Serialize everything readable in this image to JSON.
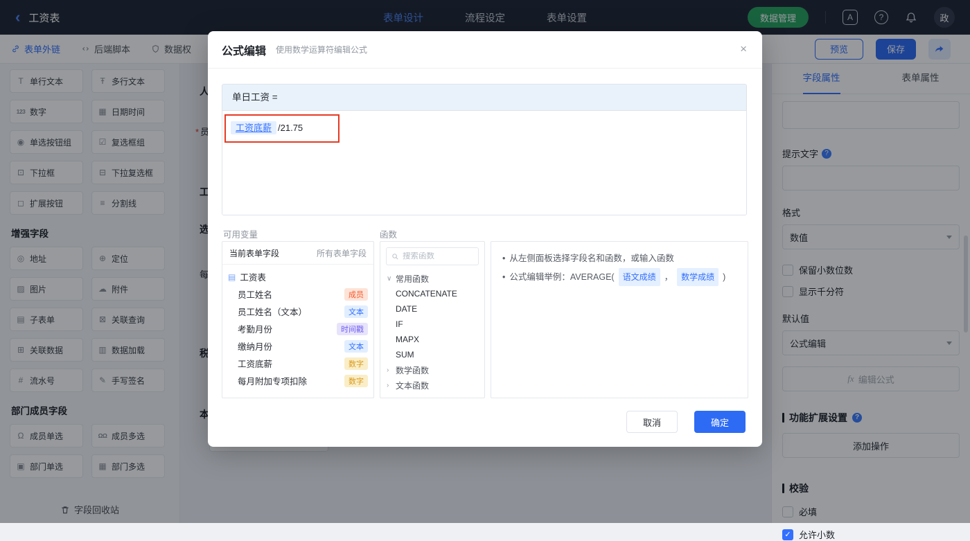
{
  "topbar": {
    "back_glyph": "‹",
    "title": "工资表",
    "tabs": [
      {
        "label": "表单设计"
      },
      {
        "label": "流程设定"
      },
      {
        "label": "表单设置"
      }
    ],
    "data_manage": "数据管理",
    "language_glyph": "A",
    "help_glyph": "?",
    "avatar": "政"
  },
  "toolbar": {
    "form_link": "表单外链",
    "backend_script": "后端脚本",
    "data_permission": "数据权",
    "preview": "预览",
    "save": "保存"
  },
  "sidebar": {
    "basic_fields": [
      {
        "icon": "T",
        "label": "单行文本"
      },
      {
        "icon": "Ŧ",
        "label": "多行文本"
      },
      {
        "icon": "123",
        "label": "数字"
      },
      {
        "icon": "▦",
        "label": "日期时间"
      },
      {
        "icon": "◉",
        "label": "单选按钮组"
      },
      {
        "icon": "☑",
        "label": "复选框组"
      },
      {
        "icon": "⊡",
        "label": "下拉框"
      },
      {
        "icon": "⊟",
        "label": "下拉复选框"
      },
      {
        "icon": "◻",
        "label": "扩展按钮"
      },
      {
        "icon": "≡",
        "label": "分割线"
      }
    ],
    "enhanced_title": "增强字段",
    "enhanced_fields": [
      {
        "icon": "◎",
        "label": "地址"
      },
      {
        "icon": "⊕",
        "label": "定位"
      },
      {
        "icon": "▨",
        "label": "图片"
      },
      {
        "icon": "☁",
        "label": "附件"
      },
      {
        "icon": "▤",
        "label": "子表单"
      },
      {
        "icon": "⊠",
        "label": "关联查询"
      },
      {
        "icon": "⊞",
        "label": "关联数据"
      },
      {
        "icon": "▥",
        "label": "数据加载"
      },
      {
        "icon": "#",
        "label": "流水号"
      },
      {
        "icon": "✎",
        "label": "手写签名"
      }
    ],
    "dept_title": "部门成员字段",
    "dept_fields": [
      {
        "icon": "Ω",
        "label": "成员单选"
      },
      {
        "icon": "ΩΩ",
        "label": "成员多选"
      },
      {
        "icon": "▣",
        "label": "部门单选"
      },
      {
        "icon": "▦",
        "label": "部门多选"
      }
    ],
    "recycle": "字段回收站"
  },
  "canvas": {
    "required_mark": "*",
    "fragments": [
      {
        "text": "人"
      },
      {
        "text": "员"
      },
      {
        "text": "工"
      },
      {
        "text": "选"
      },
      {
        "text": "每"
      },
      {
        "text": "税"
      },
      {
        "text": "本"
      }
    ]
  },
  "modal": {
    "title": "公式编辑",
    "subtitle": "使用数学运算符编辑公式",
    "close_glyph": "×",
    "formula_target": "单日工资 =",
    "formula_chip": "工资底薪",
    "formula_rest": "/21.75",
    "variables_label": "可用变量",
    "functions_label": "函数",
    "variables": {
      "tab_current": "当前表单字段",
      "tab_all": "所有表单字段",
      "root_glyph": "▤",
      "root": "工资表",
      "fields": [
        {
          "name": "员工姓名",
          "tag": "成员"
        },
        {
          "name": "员工姓名（文本）",
          "tag": "文本"
        },
        {
          "name": "考勤月份",
          "tag": "时间戳"
        },
        {
          "name": "缴纳月份",
          "tag": "文本"
        },
        {
          "name": "工资底薪",
          "tag": "数字"
        },
        {
          "name": "每月附加专项扣除",
          "tag": "数字"
        }
      ]
    },
    "functions": {
      "search_placeholder": "搜索函数",
      "chevron_down": "∨",
      "chevron_right": "›",
      "group_common": "常用函数",
      "items": [
        "CONCATENATE",
        "DATE",
        "IF",
        "MAPX",
        "SUM"
      ],
      "group_math": "数学函数",
      "group_text": "文本函数"
    },
    "help": {
      "bullet": "•",
      "line1": "从左侧面板选择字段名和函数，或输入函数",
      "line2_label": "公式编辑举例：AVERAGE(",
      "chip1": "语文成绩",
      "comma": "，",
      "chip2": "数学成绩",
      "close_paren": ")"
    },
    "cancel": "取消",
    "confirm": "确定"
  },
  "properties": {
    "tab_field": "字段属性",
    "tab_form": "表单属性",
    "hint_label": "提示文字",
    "help_glyph": "?",
    "format_label": "格式",
    "format_value": "数值",
    "keep_decimal": "保留小数位数",
    "thousand_sep": "显示千分符",
    "default_label": "默认值",
    "default_value": "公式编辑",
    "fx": "fx",
    "edit_formula": "编辑公式",
    "extension_title": "功能扩展设置",
    "add_action": "添加操作",
    "validation_title": "校验",
    "required": "必填",
    "allow_decimal": "允许小数",
    "check_glyph": "✓"
  }
}
